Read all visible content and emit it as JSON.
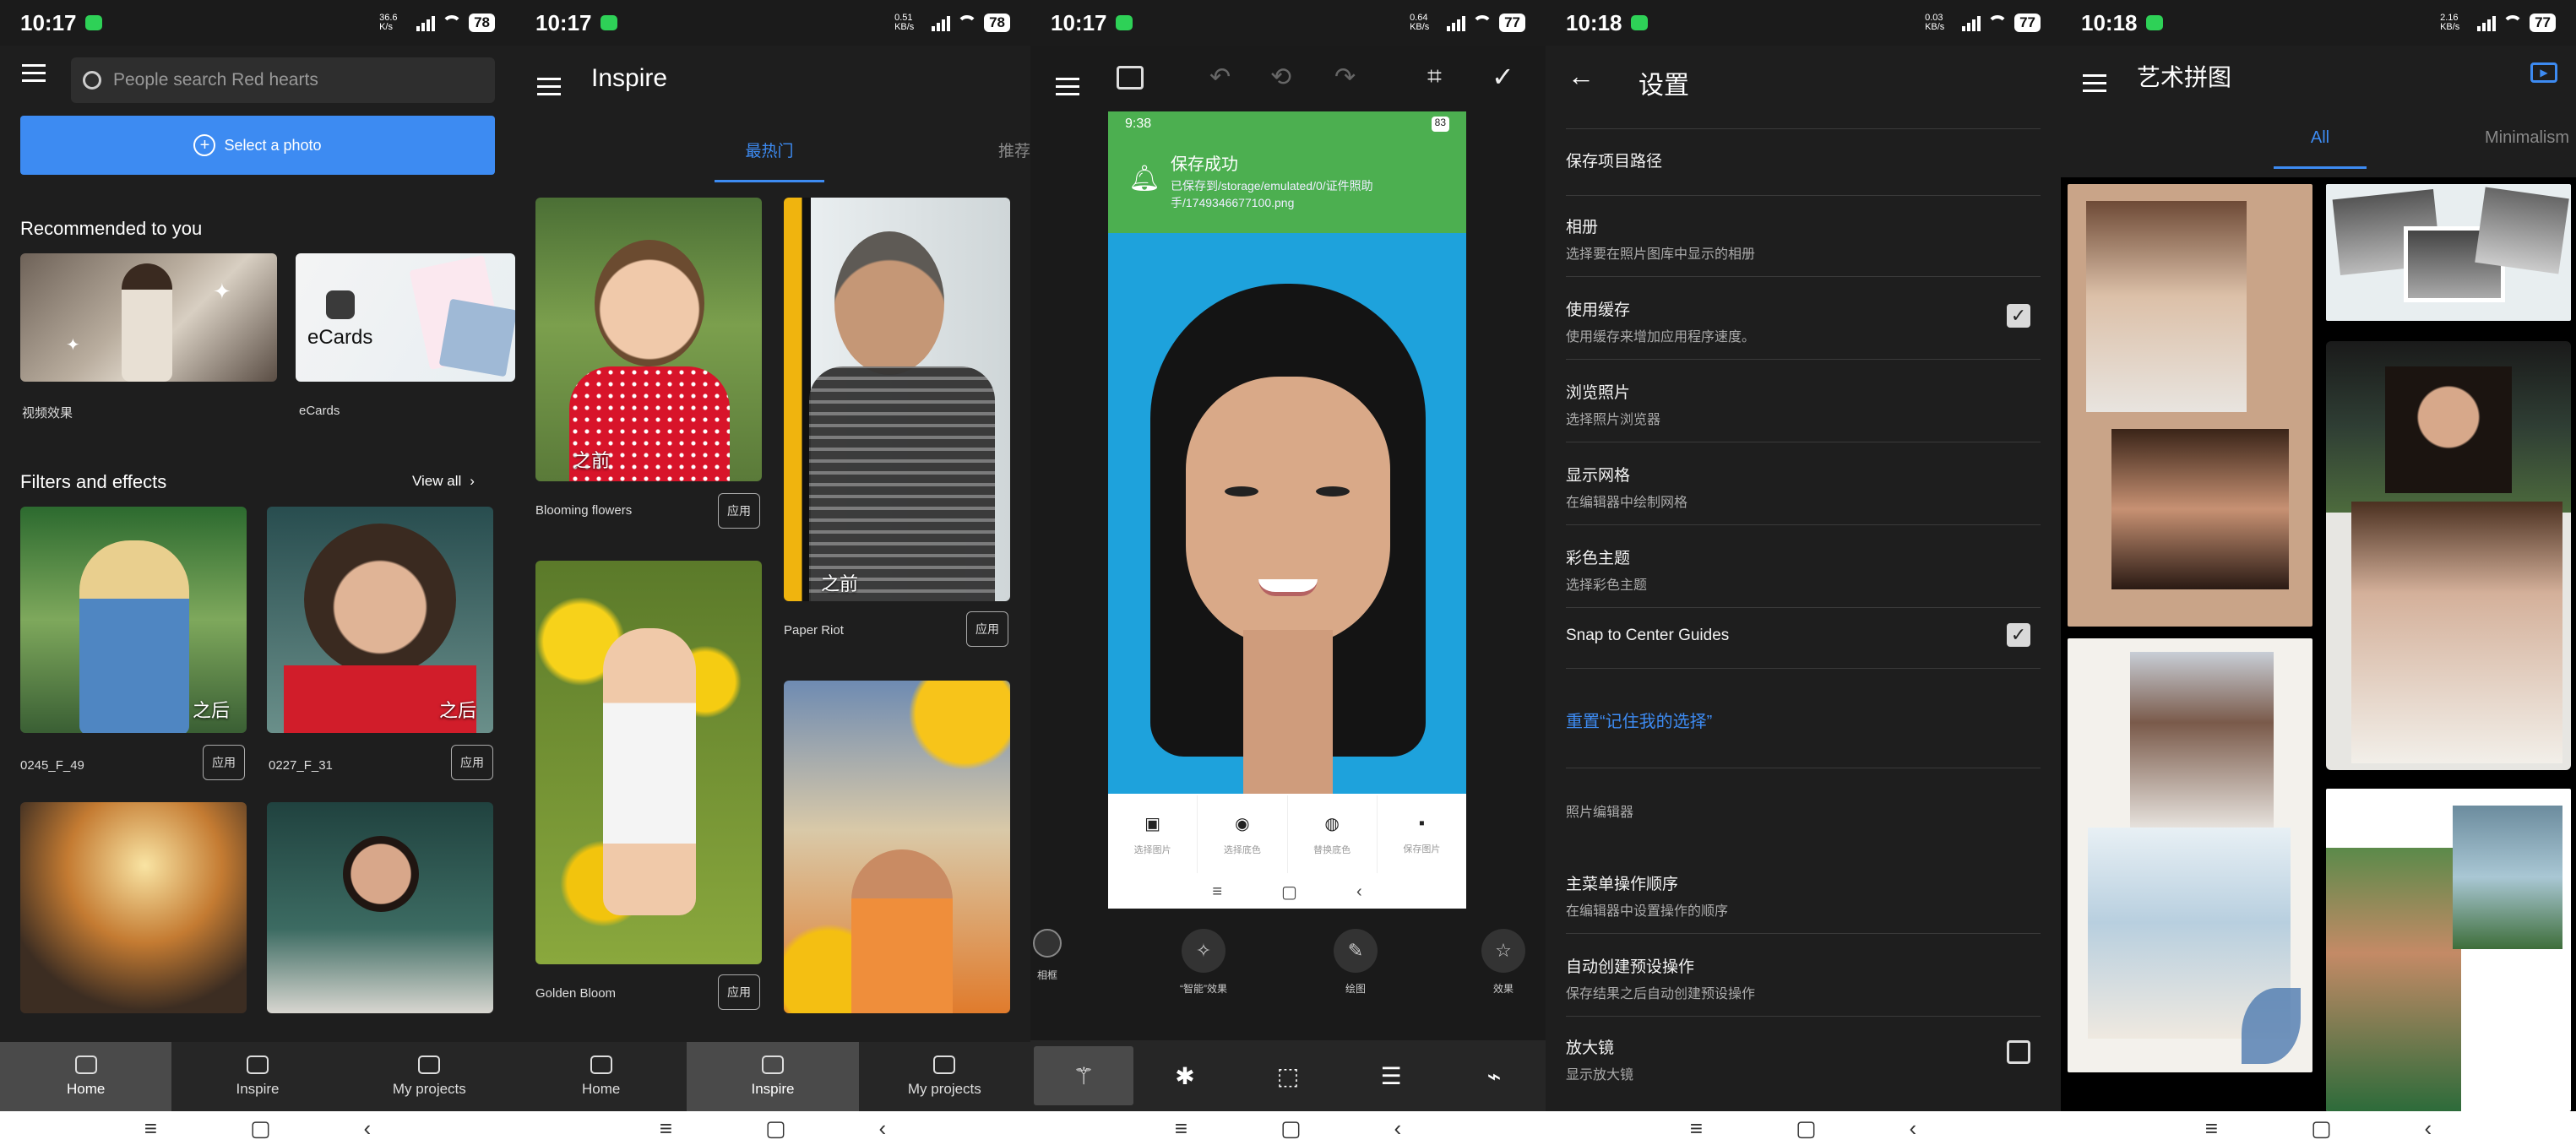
{
  "panel1": {
    "status": {
      "time": "10:17",
      "net": "36.6 K/s",
      "battery": "78"
    },
    "search_placeholder": "People search Red hearts",
    "select_photo": "Select a photo",
    "recommended_title": "Recommended to you",
    "cards": [
      {
        "label": "视频效果"
      },
      {
        "label": "eCards",
        "overlay": "eCards"
      }
    ],
    "filters_title": "Filters and effects",
    "view_all": "View all",
    "items": [
      {
        "name": "0245_F_49",
        "after": "之后",
        "apply": "应用"
      },
      {
        "name": "0227_F_31",
        "after": "之后",
        "apply": "应用"
      }
    ],
    "bottom_nav": [
      "Home",
      "Inspire",
      "My projects"
    ]
  },
  "panel2": {
    "status": {
      "time": "10:17",
      "net": "0.51 KB/s",
      "battery": "78"
    },
    "title": "Inspire",
    "tabs": [
      "最热门",
      "推荐"
    ],
    "items": [
      {
        "name": "Blooming flowers",
        "before": "之前",
        "apply": "应用"
      },
      {
        "name": "Paper Riot",
        "before": "之前",
        "apply": "应用"
      },
      {
        "name": "Golden Bloom",
        "apply": "应用"
      }
    ],
    "bottom_nav": [
      "Home",
      "Inspire",
      "My projects"
    ]
  },
  "panel3": {
    "status": {
      "time": "10:17",
      "net": "0.64 KB/s",
      "battery": "77"
    },
    "inner_status_time": "9:38",
    "inner_battery": "83",
    "notif_title": "保存成功",
    "notif_body": "已保存到/storage/emulated/0/证件照助手/1749346677100.png",
    "inner_actions": [
      "选择图片",
      "选择底色",
      "替换底色",
      "保存图片"
    ],
    "tools": [
      "相框",
      "“智能”效果",
      "绘图",
      "效果"
    ]
  },
  "panel4": {
    "status": {
      "time": "10:18",
      "net": "0.03 KB/s",
      "battery": "77"
    },
    "title": "设置",
    "rows": [
      {
        "title": "保存项目路径",
        "sub": ""
      },
      {
        "title": "相册",
        "sub": "选择要在照片图库中显示的相册"
      },
      {
        "title": "使用缓存",
        "sub": "使用缓存来增加应用程序速度。"
      },
      {
        "title": "浏览照片",
        "sub": "选择照片浏览器"
      },
      {
        "title": "显示网格",
        "sub": "在编辑器中绘制网格"
      },
      {
        "title": "彩色主题",
        "sub": "选择彩色主题"
      },
      {
        "title": "Snap to Center Guides",
        "sub": ""
      },
      {
        "title": "重置“记住我的选择”",
        "sub": ""
      },
      {
        "title": "照片编辑器",
        "sub": ""
      },
      {
        "title": "主菜单操作顺序",
        "sub": "在编辑器中设置操作的顺序"
      },
      {
        "title": "自动创建预设操作",
        "sub": "保存结果之后自动创建预设操作"
      },
      {
        "title": "放大镜",
        "sub": "显示放大镜"
      }
    ],
    "checks": {
      "cache": true,
      "snap": true,
      "magnifier": false
    }
  },
  "panel5": {
    "status": {
      "time": "10:18",
      "net": "2.16 KB/s",
      "battery": "77"
    },
    "title": "艺术拼图",
    "tabs": [
      "All",
      "Minimalism"
    ]
  },
  "colors": {
    "accent": "#3d8bf2",
    "select_btn": "#3d8bf2",
    "notif_green": "#4caf50",
    "id_bg": "#1ea2dc"
  }
}
